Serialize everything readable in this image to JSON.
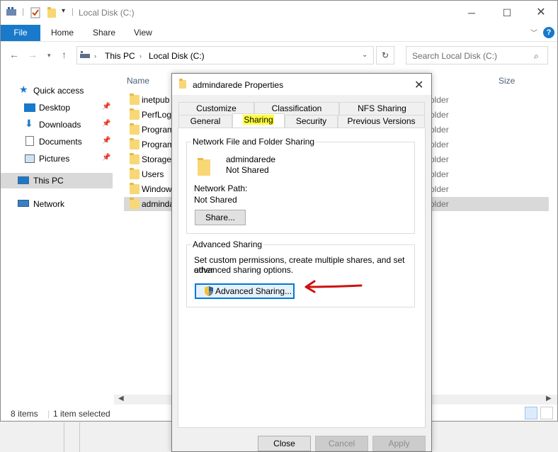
{
  "explorer": {
    "title": "Local Disk (C:)",
    "ribbon_tabs": [
      "File",
      "Home",
      "Share",
      "View"
    ],
    "breadcrumb": [
      "This PC",
      "Local Disk (C:)"
    ],
    "search_placeholder": "Search Local Disk (C:)",
    "columns": {
      "name": "Name",
      "size": "Size"
    },
    "nav": {
      "quick_access": "Quick access",
      "desktop": "Desktop",
      "downloads": "Downloads",
      "documents": "Documents",
      "pictures": "Pictures",
      "this_pc": "This PC",
      "network": "Network"
    },
    "files": [
      {
        "name": "inetpub",
        "type": "older"
      },
      {
        "name": "PerfLogs",
        "type": "older"
      },
      {
        "name": "Program",
        "type": "older"
      },
      {
        "name": "Program",
        "type": "older"
      },
      {
        "name": "StorageR",
        "type": "older"
      },
      {
        "name": "Users",
        "type": "older"
      },
      {
        "name": "Window",
        "type": "older"
      },
      {
        "name": "adminda",
        "type": "older"
      }
    ],
    "status": {
      "items": "8 items",
      "selected": "1 item selected"
    }
  },
  "dialog": {
    "title": "admindarede Properties",
    "tabs_row1": [
      "Customize",
      "Classification",
      "NFS Sharing"
    ],
    "tabs_row2": [
      "General",
      "Sharing",
      "Security",
      "Previous Versions"
    ],
    "network_sharing": {
      "label": "Network File and Folder Sharing",
      "folder_name": "admindarede",
      "share_state": "Not Shared",
      "path_label": "Network Path:",
      "path_value": "Not Shared",
      "share_button": "Share..."
    },
    "advanced_sharing": {
      "label": "Advanced Sharing",
      "description_line1": "Set custom permissions, create multiple shares, and set other",
      "description_line2": "advanced sharing options.",
      "button": "Advanced Sharing..."
    },
    "buttons": {
      "close": "Close",
      "cancel": "Cancel",
      "apply": "Apply"
    }
  },
  "colors": {
    "accent": "#1979ca",
    "highlight": "#ffff3c",
    "arrow": "#d01010",
    "folder": "#f8d775"
  }
}
